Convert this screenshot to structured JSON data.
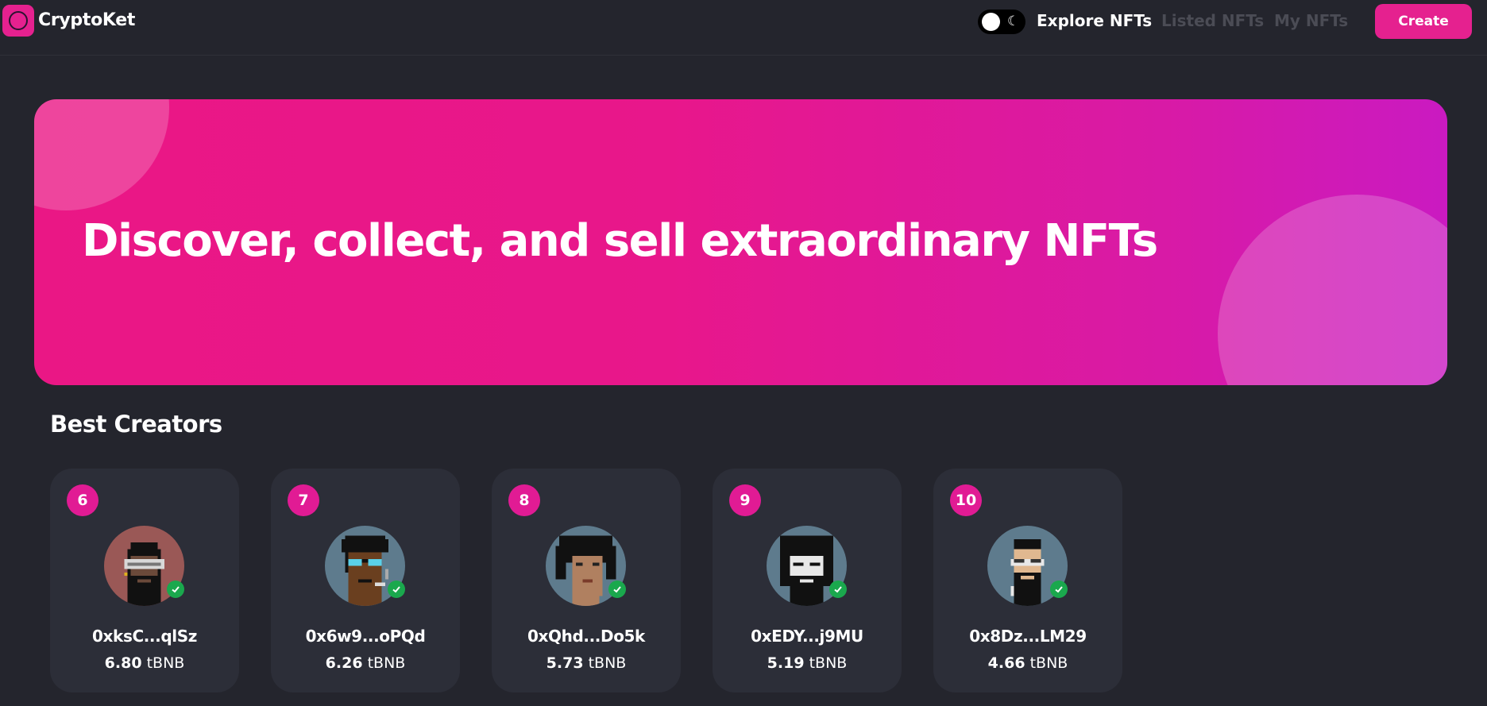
{
  "app": {
    "brand": "CryptoKet",
    "logo_icon": "ring-logo-icon",
    "accent_color": "#e5218f"
  },
  "nav": {
    "theme_toggle_icon": "moon-icon",
    "links": [
      {
        "label": "Explore NFTs",
        "active": true
      },
      {
        "label": "Listed NFTs",
        "active": false
      },
      {
        "label": "My NFTs",
        "active": false
      }
    ],
    "create_label": "Create"
  },
  "banner": {
    "title": "Discover, collect, and sell extraordinary NFTs"
  },
  "creators": {
    "title": "Best Creators",
    "items": [
      {
        "rank": "6",
        "name": "0xksC...qlSz",
        "amount": "6.80",
        "currency": "tBNB",
        "bg": "#9a5856"
      },
      {
        "rank": "7",
        "name": "0x6w9...oPQd",
        "amount": "6.26",
        "currency": "tBNB",
        "bg": "#5e7b8d"
      },
      {
        "rank": "8",
        "name": "0xQhd...Do5k",
        "amount": "5.73",
        "currency": "tBNB",
        "bg": "#5e7b8d"
      },
      {
        "rank": "9",
        "name": "0xEDY...j9MU",
        "amount": "5.19",
        "currency": "tBNB",
        "bg": "#5e7b8d"
      },
      {
        "rank": "10",
        "name": "0x8Dz...LM29",
        "amount": "4.66",
        "currency": "tBNB",
        "bg": "#5e7b8d"
      }
    ]
  }
}
